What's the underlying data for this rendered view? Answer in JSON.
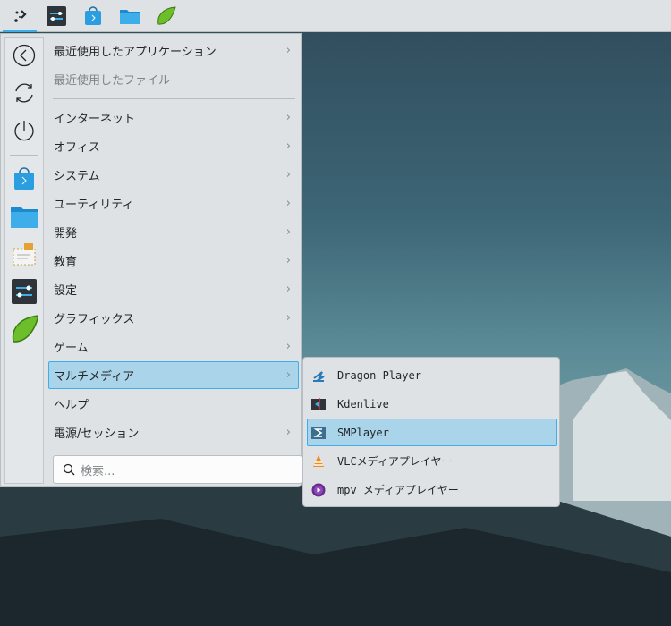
{
  "panel": {
    "items": [
      "application-launcher",
      "system-settings",
      "discover",
      "file-manager",
      "krita"
    ]
  },
  "menu": {
    "items": [
      {
        "label": "最近使用したアプリケーション",
        "submenu": true
      },
      {
        "label": "最近使用したファイル",
        "submenu": false,
        "dim": true
      },
      {
        "label": "インターネット",
        "submenu": true
      },
      {
        "label": "オフィス",
        "submenu": true
      },
      {
        "label": "システム",
        "submenu": true
      },
      {
        "label": "ユーティリティ",
        "submenu": true
      },
      {
        "label": "開発",
        "submenu": true
      },
      {
        "label": "教育",
        "submenu": true
      },
      {
        "label": "設定",
        "submenu": true
      },
      {
        "label": "グラフィックス",
        "submenu": true
      },
      {
        "label": "ゲーム",
        "submenu": true
      },
      {
        "label": "マルチメディア",
        "submenu": true,
        "selected": true
      },
      {
        "label": "ヘルプ",
        "submenu": false
      },
      {
        "label": "電源/セッション",
        "submenu": true
      }
    ],
    "search_placeholder": "検索...",
    "chevron": "›"
  },
  "submenu": {
    "items": [
      {
        "label": "Dragon Player",
        "icon": "dragon-player-icon"
      },
      {
        "label": "Kdenlive",
        "icon": "kdenlive-icon"
      },
      {
        "label": "SMPlayer",
        "icon": "smplayer-icon",
        "selected": true
      },
      {
        "label": "VLCメディアプレイヤー",
        "icon": "vlc-icon"
      },
      {
        "label": "mpv メディアプレイヤー",
        "icon": "mpv-icon"
      }
    ]
  },
  "colors": {
    "accent": "#3daee9",
    "selection": "#a9d4ea",
    "panel": "#dee2e5"
  }
}
